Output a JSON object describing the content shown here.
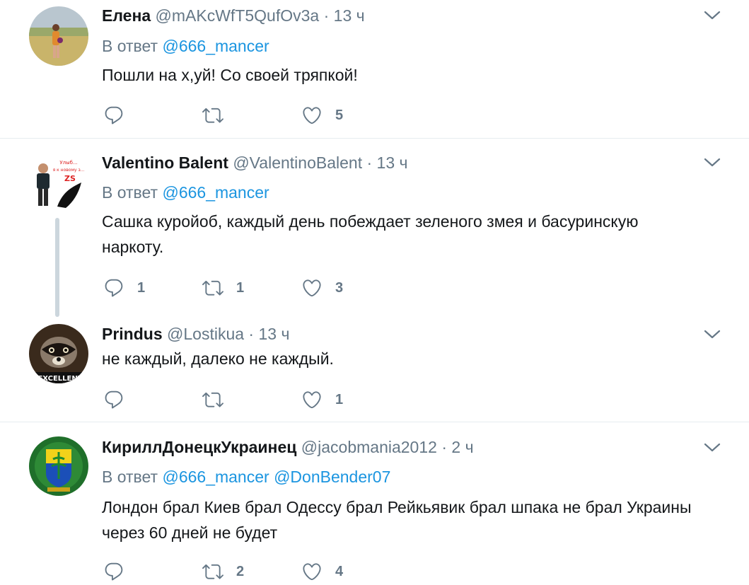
{
  "tweets": [
    {
      "name": "Елена",
      "handle": "@mAKcWfT5QufOv3a",
      "dot": "·",
      "time": "13 ч",
      "reply_prefix": "В ответ",
      "reply_mentions": "@666_mancer",
      "text": "Пошли на х,уй! Со своей тряпкой!",
      "replies": "",
      "retweets": "",
      "likes": "5"
    },
    {
      "name": "Valentino Balent",
      "handle": "@ValentinoBalent",
      "dot": "·",
      "time": "13 ч",
      "reply_prefix": "В ответ",
      "reply_mentions": "@666_mancer",
      "text": "Сашка куройоб, каждый день побеждает зеленого змея и басуринскую наркоту.",
      "replies": "1",
      "retweets": "1",
      "likes": "3"
    },
    {
      "name": "Prindus",
      "handle": "@Lostikua",
      "dot": "·",
      "time": "13 ч",
      "text": "не каждый, далеко не каждый.",
      "replies": "",
      "retweets": "",
      "likes": "1"
    },
    {
      "name": "КириллДонецкУкраинец",
      "handle": "@jacobmania2012",
      "dot": "·",
      "time": "2 ч",
      "reply_prefix": "В ответ",
      "reply_mentions": "@666_mancer @DonBender07",
      "text": "Лондон брал Киев брал Одессу брал Рейкьявик брал шпака не брал Украины через 60 дней не будет",
      "replies": "",
      "retweets": "2",
      "likes": "4"
    }
  ],
  "avatar_badges": {
    "t2": "Улыб... я к новому з...",
    "t3": "EXCELLENT"
  },
  "icons": {
    "reply": "reply-icon",
    "retweet": "retweet-icon",
    "like": "heart-icon",
    "more": "chevron-down-icon"
  },
  "colors": {
    "text": "#14171a",
    "secondary": "#657786",
    "link": "#1b95e0",
    "divider": "#e6ecf0",
    "thread_line": "#ccd6dd"
  }
}
